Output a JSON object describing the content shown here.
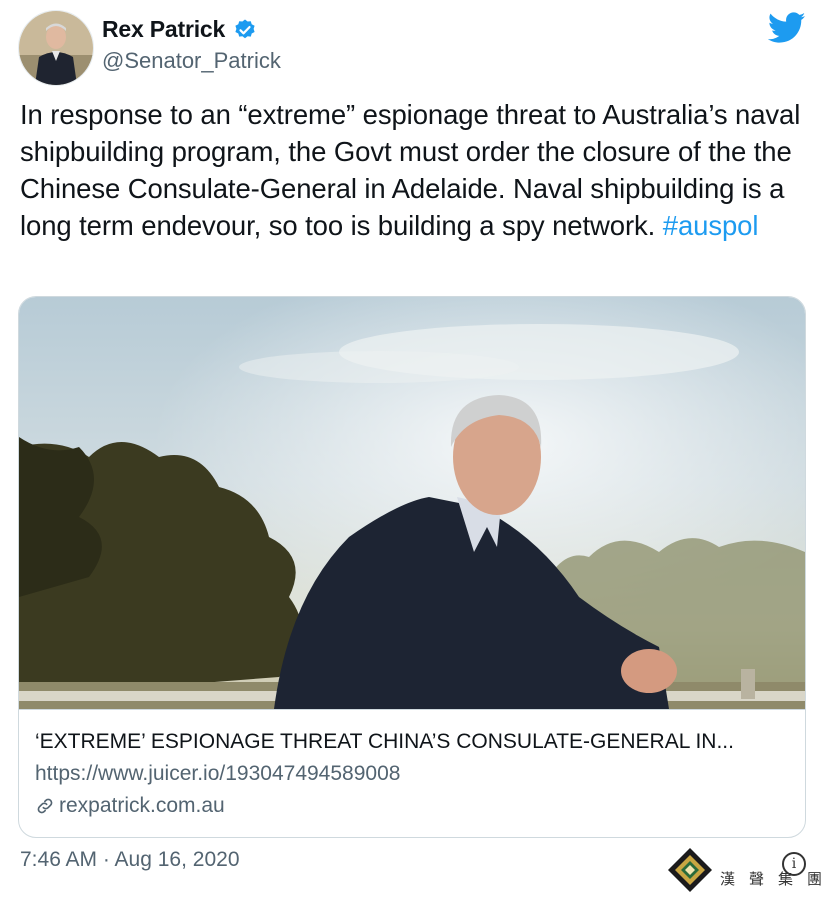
{
  "author": {
    "display_name": "Rex Patrick",
    "handle": "@Senator_Patrick",
    "verified": true
  },
  "tweet": {
    "text": "In response to an “extreme” espionage threat to Australia’s naval shipbuilding program, the Govt must order the closure of the the Chinese Consulate-General in Adelaide. Naval shipbuilding is a long term endevour, so too is building a spy network. ",
    "hashtag": "#auspol"
  },
  "card": {
    "title": "‘EXTREME’ ESPIONAGE THREAT CHINA’S CONSULATE-GENERAL IN...",
    "url": "https://www.juicer.io/193047494589008",
    "domain": "rexpatrick.com.au"
  },
  "timestamp": "7:46 AM · Aug 16, 2020",
  "watermark": {
    "text": "漢聲集團"
  },
  "colors": {
    "link": "#1d9bf0",
    "secondary_text": "#536471",
    "border": "#cfd9de",
    "brand": "#1d9bf0"
  },
  "icons": [
    "verified-badge-icon",
    "twitter-bird-icon",
    "link-icon",
    "info-icon"
  ]
}
